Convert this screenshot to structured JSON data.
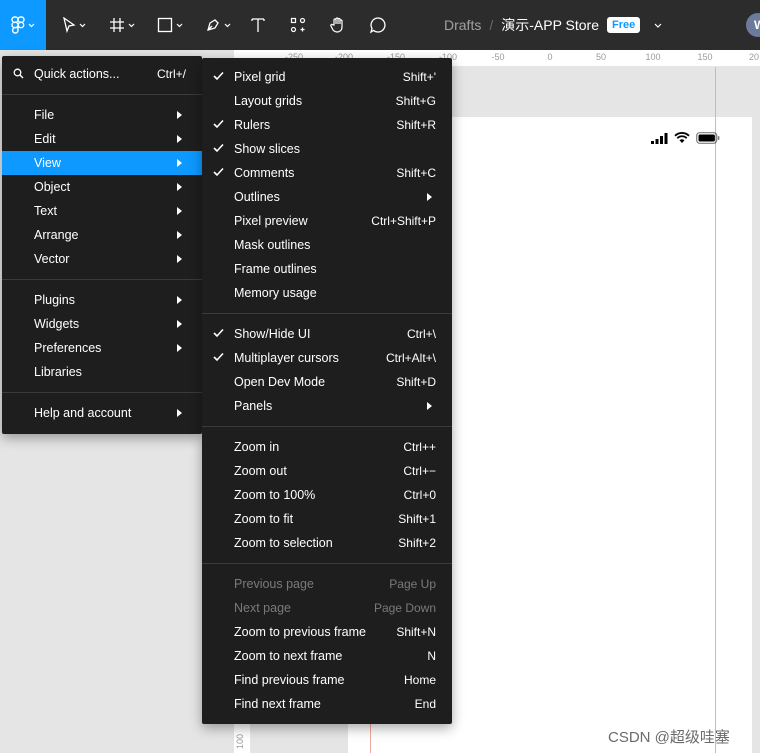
{
  "toolbar": {
    "tools": [
      {
        "icon": "figma-menu-icon",
        "active": true
      },
      {
        "icon": "move-tool-icon"
      },
      {
        "icon": "frame-tool-icon"
      },
      {
        "icon": "rectangle-tool-icon"
      },
      {
        "icon": "pen-tool-icon"
      },
      {
        "icon": "text-tool-icon"
      },
      {
        "icon": "resources-icon"
      },
      {
        "icon": "hand-tool-icon"
      },
      {
        "icon": "comment-tool-icon"
      }
    ],
    "breadcrumb": {
      "folder": "Drafts",
      "separator": "/",
      "file": "演示-APP Store",
      "badge": "Free"
    },
    "avatar_initial": "W",
    "accent": "#0d99ff"
  },
  "ruler": {
    "top_ticks": [
      "-250",
      "-200",
      "-150",
      "-100",
      "-50",
      "0",
      "50",
      "100",
      "150",
      "20"
    ],
    "left_ticks": [
      "100"
    ]
  },
  "main_menu": {
    "quick_actions": {
      "label": "Quick actions...",
      "shortcut": "Ctrl+/"
    },
    "group1": [
      "File",
      "Edit",
      "View",
      "Object",
      "Text",
      "Arrange",
      "Vector"
    ],
    "group2": [
      "Plugins",
      "Widgets",
      "Preferences",
      "Libraries"
    ],
    "group3": [
      "Help and account"
    ],
    "highlighted": "View"
  },
  "view_menu": {
    "group1": [
      {
        "label": "Pixel grid",
        "shortcut": "Shift+'",
        "checked": true
      },
      {
        "label": "Layout grids",
        "shortcut": "Shift+G",
        "checked": false
      },
      {
        "label": "Rulers",
        "shortcut": "Shift+R",
        "checked": true
      },
      {
        "label": "Show slices",
        "shortcut": "",
        "checked": true
      },
      {
        "label": "Comments",
        "shortcut": "Shift+C",
        "checked": true
      },
      {
        "label": "Outlines",
        "shortcut": "",
        "checked": false,
        "submenu": true
      },
      {
        "label": "Pixel preview",
        "shortcut": "Ctrl+Shift+P",
        "checked": false
      },
      {
        "label": "Mask outlines",
        "shortcut": "",
        "checked": false
      },
      {
        "label": "Frame outlines",
        "shortcut": "",
        "checked": false
      },
      {
        "label": "Memory usage",
        "shortcut": "",
        "checked": false
      }
    ],
    "group2": [
      {
        "label": "Show/Hide UI",
        "shortcut": "Ctrl+\\",
        "checked": true
      },
      {
        "label": "Multiplayer cursors",
        "shortcut": "Ctrl+Alt+\\",
        "checked": true
      },
      {
        "label": "Open Dev Mode",
        "shortcut": "Shift+D",
        "checked": false
      },
      {
        "label": "Panels",
        "shortcut": "",
        "checked": false,
        "submenu": true
      }
    ],
    "group3": [
      {
        "label": "Zoom in",
        "shortcut": "Ctrl++"
      },
      {
        "label": "Zoom out",
        "shortcut": "Ctrl+−"
      },
      {
        "label": "Zoom to 100%",
        "shortcut": "Ctrl+0"
      },
      {
        "label": "Zoom to fit",
        "shortcut": "Shift+1"
      },
      {
        "label": "Zoom to selection",
        "shortcut": "Shift+2"
      }
    ],
    "group4": [
      {
        "label": "Previous page",
        "shortcut": "Page Up",
        "disabled": true
      },
      {
        "label": "Next page",
        "shortcut": "Page Down",
        "disabled": true
      },
      {
        "label": "Zoom to previous frame",
        "shortcut": "Shift+N"
      },
      {
        "label": "Zoom to next frame",
        "shortcut": "N"
      },
      {
        "label": "Find previous frame",
        "shortcut": "Home"
      },
      {
        "label": "Find next frame",
        "shortcut": "End"
      }
    ]
  },
  "watermark": "CSDN @超级哇塞"
}
